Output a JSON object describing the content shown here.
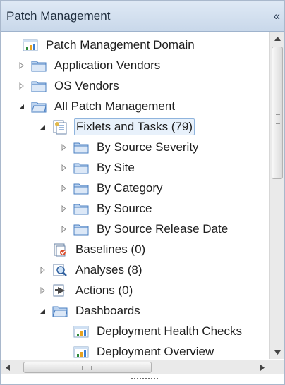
{
  "panel": {
    "title": "Patch Management",
    "collapse_glyph": "«"
  },
  "tree": {
    "items": [
      {
        "label": "Patch Management Domain",
        "icon": "domain-chart-icon",
        "toggle": "none"
      },
      {
        "label": "Application Vendors",
        "icon": "folder-icon",
        "toggle": "collapsed"
      },
      {
        "label": "OS Vendors",
        "icon": "folder-icon",
        "toggle": "collapsed"
      },
      {
        "label": "All Patch Management",
        "icon": "folder-icon",
        "toggle": "expanded"
      },
      {
        "label": "Fixlets and Tasks (79)",
        "icon": "fixlets-icon",
        "toggle": "expanded",
        "selected": true
      },
      {
        "label": "By Source Severity",
        "icon": "folder-icon",
        "toggle": "collapsed"
      },
      {
        "label": "By Site",
        "icon": "folder-icon",
        "toggle": "collapsed"
      },
      {
        "label": "By Category",
        "icon": "folder-icon",
        "toggle": "collapsed"
      },
      {
        "label": "By Source",
        "icon": "folder-icon",
        "toggle": "collapsed"
      },
      {
        "label": "By Source Release Date",
        "icon": "folder-icon",
        "toggle": "collapsed"
      },
      {
        "label": "Baselines (0)",
        "icon": "baselines-icon",
        "toggle": "none"
      },
      {
        "label": "Analyses (8)",
        "icon": "analyses-icon",
        "toggle": "collapsed"
      },
      {
        "label": "Actions (0)",
        "icon": "actions-icon",
        "toggle": "collapsed"
      },
      {
        "label": "Dashboards",
        "icon": "folder-icon",
        "toggle": "expanded"
      },
      {
        "label": "Deployment Health Checks",
        "icon": "dashboard-chart-icon",
        "toggle": "none"
      },
      {
        "label": "Deployment Overview",
        "icon": "dashboard-chart-icon",
        "toggle": "none"
      }
    ]
  },
  "scrollbars": {
    "horizontal_grip": "III"
  },
  "colors": {
    "folder": "#4a7fc2",
    "folder_light": "#bcd3ef",
    "selection_border": "#8fb4dd",
    "selection_fill": "#e8f1fb",
    "header_top": "#dfe9f5",
    "header_bottom": "#c9d8ea"
  }
}
